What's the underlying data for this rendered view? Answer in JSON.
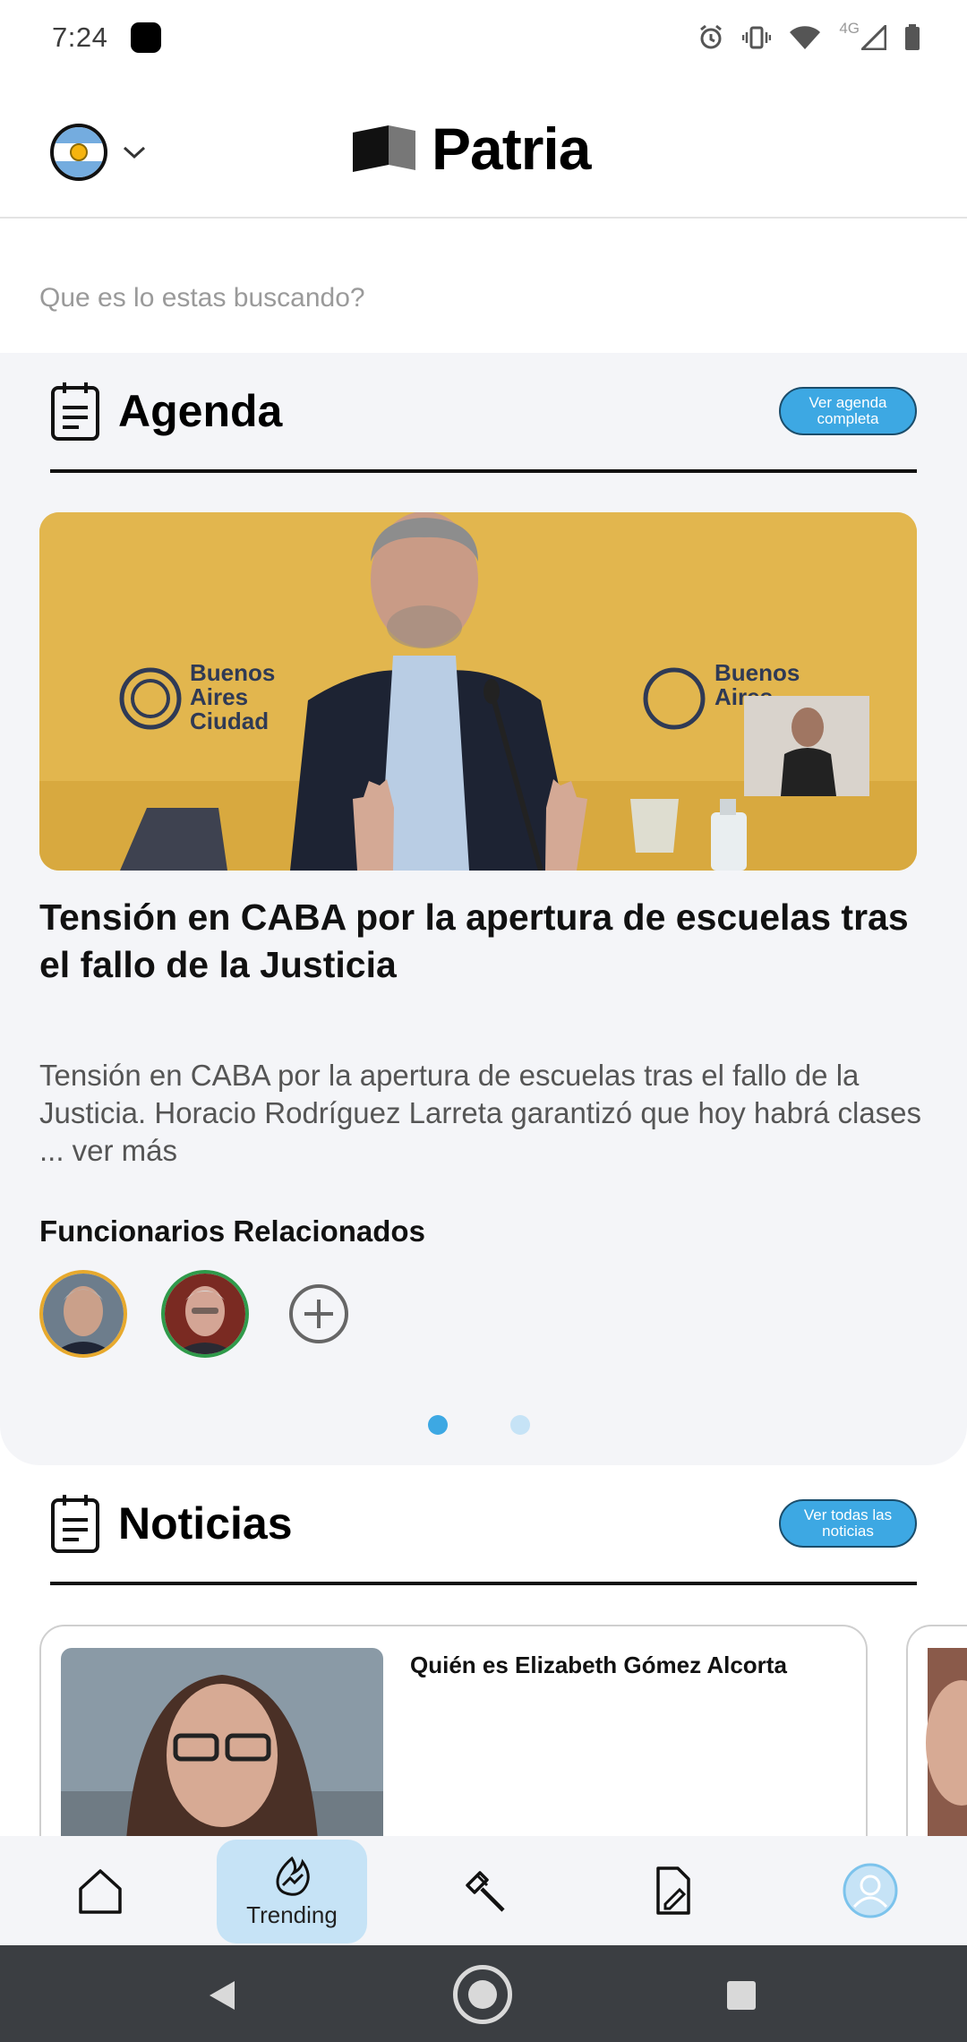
{
  "status_bar": {
    "time": "7:24",
    "network": "4G"
  },
  "header": {
    "logo_text": "Patria",
    "country_flag": "argentina-flag"
  },
  "search": {
    "placeholder": "Que es lo estas buscando?"
  },
  "agenda": {
    "title": "Agenda",
    "button_label": "Ver agenda completa",
    "hero_image_text": [
      "Buenos",
      "Aires",
      "Ciudad"
    ],
    "headline": "Tensión en CABA por la apertura de escuelas tras el fallo de la Justicia",
    "summary": "Tensión en CABA por la apertura de escuelas tras el fallo de la Justicia. Horacio Rodríguez Larreta garantizó que hoy habrá clases",
    "summary_more": " ... ver más",
    "related_title": "Funcionarios Relacionados",
    "related_officials": [
      "official-1",
      "official-2"
    ],
    "carousel": {
      "total_pages": 2,
      "active_page": 1
    }
  },
  "noticias": {
    "title": "Noticias",
    "button_label": "Ver todas las noticias",
    "cards": [
      {
        "title": "Quién es Elizabeth Gómez Alcorta"
      }
    ]
  },
  "bottom_nav": {
    "items": [
      {
        "icon": "home-icon",
        "label": ""
      },
      {
        "icon": "trending-icon",
        "label": "Trending",
        "active": true
      },
      {
        "icon": "gavel-icon",
        "label": ""
      },
      {
        "icon": "document-icon",
        "label": ""
      },
      {
        "icon": "profile-icon",
        "label": ""
      }
    ]
  },
  "colors": {
    "accent": "#3da8e3",
    "accent_light": "#c6e3f6",
    "section_bg": "#f4f5f8"
  }
}
